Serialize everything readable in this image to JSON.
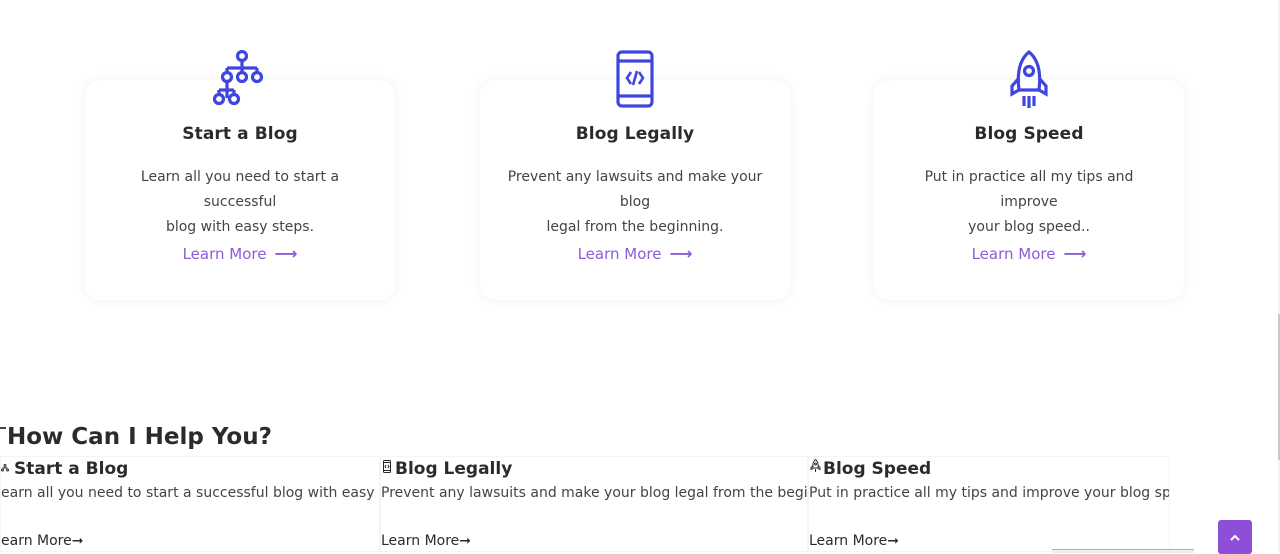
{
  "cards": [
    {
      "icon": "sitemap-icon",
      "title": "Start a Blog",
      "desc_line1": "Learn all you need to start a successful",
      "desc_line2": "blog with easy steps.",
      "link": "Learn More",
      "link_arrow": "⟶"
    },
    {
      "icon": "mobile-code-icon",
      "title": "Blog Legally",
      "desc_line1": "Prevent any lawsuits and make your blog",
      "desc_line2": "legal from the beginning.",
      "link": "Learn More",
      "link_arrow": "⟶"
    },
    {
      "icon": "rocket-icon",
      "title": "Blog Speed",
      "desc_line1": "Put in practice all my tips and improve",
      "desc_line2": "your blog speed..",
      "link": "Learn More",
      "link_arrow": "⟶"
    }
  ],
  "help": {
    "heading": "How Can I Help You?",
    "columns": [
      {
        "title": "Start a Blog",
        "desc": "earn all you need to start a successful blog with easy steps.",
        "link": "earn More➞"
      },
      {
        "title": "Blog Legally",
        "desc": "Prevent any lawsuits and make your blog legal from the beginning.",
        "link": "Learn More➞"
      },
      {
        "title": "Blog Speed",
        "desc": "Put in practice all my tips and improve your blog speed..",
        "link": "Learn More➞"
      }
    ]
  },
  "colors": {
    "icon_blue": "#3f46e0",
    "accent_purple": "#8e5bd9",
    "button_purple": "#8e4fd8"
  }
}
